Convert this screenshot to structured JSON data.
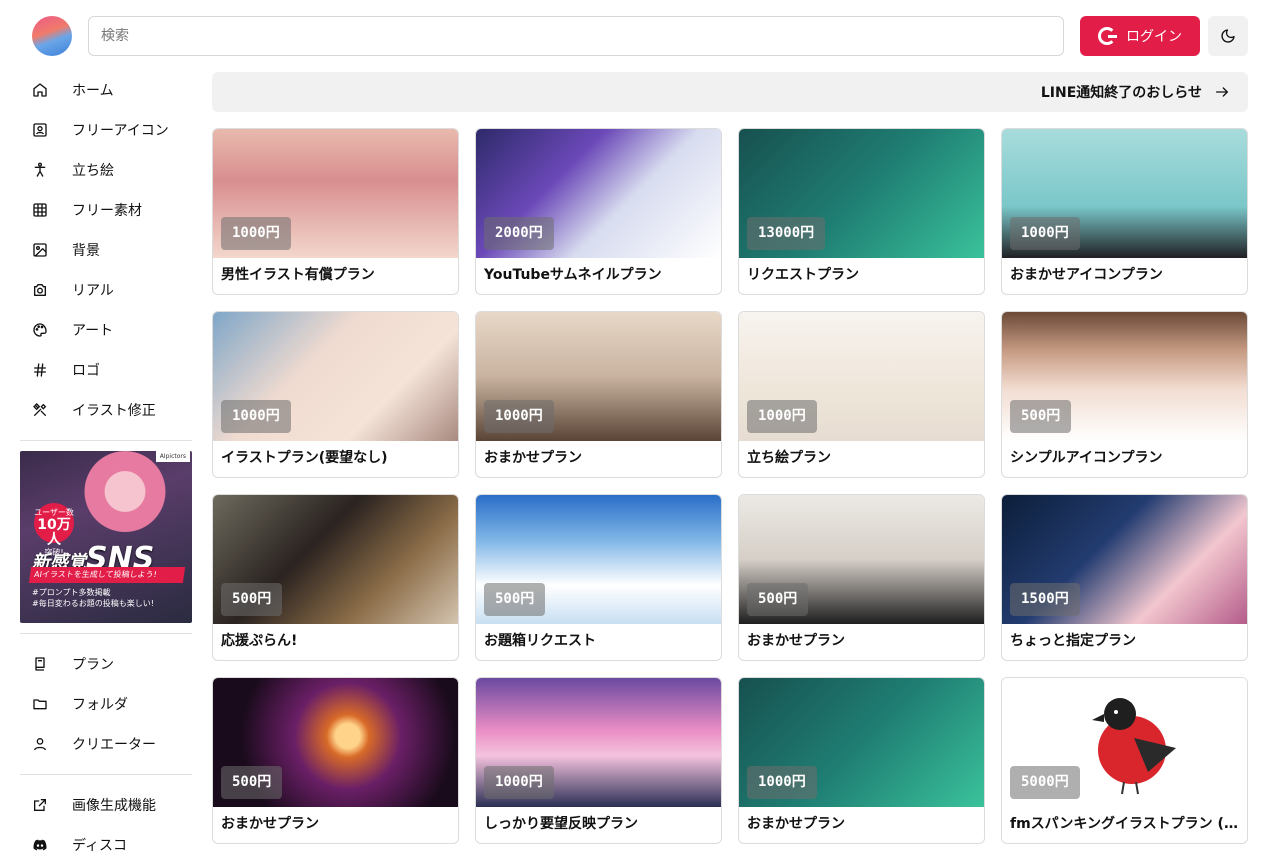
{
  "header": {
    "search_placeholder": "検索",
    "login_label": "ログイン"
  },
  "sidebar": {
    "items": [
      {
        "label": "ホーム",
        "icon": "home-icon"
      },
      {
        "label": "フリーアイコン",
        "icon": "portrait-icon"
      },
      {
        "label": "立ち絵",
        "icon": "person-standing-icon"
      },
      {
        "label": "フリー素材",
        "icon": "grid-icon"
      },
      {
        "label": "背景",
        "icon": "image-icon"
      },
      {
        "label": "リアル",
        "icon": "camera-icon"
      },
      {
        "label": "アート",
        "icon": "palette-icon"
      },
      {
        "label": "ロゴ",
        "icon": "hash-icon"
      },
      {
        "label": "イラスト修正",
        "icon": "tools-icon"
      }
    ],
    "banner": {
      "brand": "AIpictors",
      "badge_top": "ユーザー数",
      "badge_num": "10万人",
      "badge_bottom": "突破!",
      "headline_pre": "新感覚",
      "headline_main": "SNS",
      "strip": "AIイラストを生成して投稿しよう!",
      "sub1": "#プロンプト多数掲載",
      "sub2": "#毎日変わるお題の投稿も楽しい!"
    },
    "items2": [
      {
        "label": "プラン",
        "icon": "plan-icon"
      },
      {
        "label": "フォルダ",
        "icon": "folder-icon"
      },
      {
        "label": "クリエーター",
        "icon": "user-icon"
      }
    ],
    "items3": [
      {
        "label": "画像生成機能",
        "icon": "external-link-icon"
      },
      {
        "label": "ディスコ",
        "icon": "discord-icon"
      }
    ]
  },
  "notice": {
    "label": "LINE通知終了のおしらせ"
  },
  "plans": [
    {
      "title": "男性イラスト有償プラン",
      "price": "1000円"
    },
    {
      "title": "YouTubeサムネイルプラン",
      "price": "2000円"
    },
    {
      "title": "リクエストプラン",
      "price": "13000円"
    },
    {
      "title": "おまかせアイコンプラン",
      "price": "1000円"
    },
    {
      "title": "イラストプラン(要望なし)",
      "price": "1000円"
    },
    {
      "title": "おまかせプラン",
      "price": "1000円"
    },
    {
      "title": "立ち絵プラン",
      "price": "1000円"
    },
    {
      "title": "シンプルアイコンプラン",
      "price": "500円"
    },
    {
      "title": "応援ぷらん!",
      "price": "500円"
    },
    {
      "title": "お題箱リクエスト",
      "price": "500円"
    },
    {
      "title": "おまかせプラン",
      "price": "500円"
    },
    {
      "title": "ちょっと指定プラン",
      "price": "1500円"
    },
    {
      "title": "おまかせプラン",
      "price": "500円"
    },
    {
      "title": "しっかり要望反映プラン",
      "price": "1000円"
    },
    {
      "title": "おまかせプラン",
      "price": "1000円"
    },
    {
      "title": "fmスパンキングイラストプラン (…",
      "price": "5000円"
    }
  ],
  "colors": {
    "accent": "#e11d48",
    "notice_bg": "#f1f1f1"
  }
}
